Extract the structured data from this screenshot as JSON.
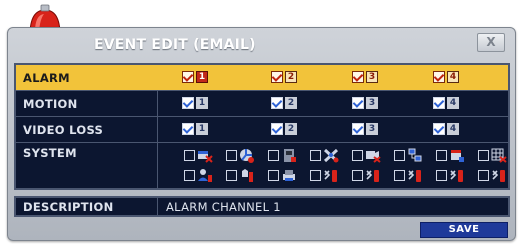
{
  "window": {
    "title": "EVENT EDIT (EMAIL)",
    "close_label": "X"
  },
  "grid": {
    "rows": [
      {
        "label": "ALARM",
        "selected": true,
        "checks": [
          "1",
          "2",
          "3",
          "4"
        ]
      },
      {
        "label": "MOTION",
        "selected": false,
        "checks": [
          "1",
          "2",
          "3",
          "4"
        ]
      },
      {
        "label": "VIDEO LOSS",
        "selected": false,
        "checks": [
          "1",
          "2",
          "3",
          "4"
        ]
      }
    ],
    "system": {
      "label": "SYSTEM",
      "icons_row1": [
        "disk-error-icon",
        "fan-icon",
        "disk-full-icon",
        "fan-error-icon",
        "video-error-icon",
        "network-icon",
        "hdd-fail-icon",
        "disk-grid-icon"
      ],
      "icons_row2": [
        "login-fail-icon",
        "power-icon",
        "print-icon",
        "recording-error-icon",
        "recording-error-icon",
        "recording-error-icon",
        "recording-error-icon",
        "recording-error-icon"
      ]
    }
  },
  "description": {
    "label": "DESCRIPTION",
    "value": "ALARM CHANNEL 1"
  },
  "buttons": {
    "save": "SAVE"
  },
  "colors": {
    "selected_row": "#f2c33a",
    "panel_bg": "#0c1630",
    "save_button": "#1f3a9a"
  }
}
